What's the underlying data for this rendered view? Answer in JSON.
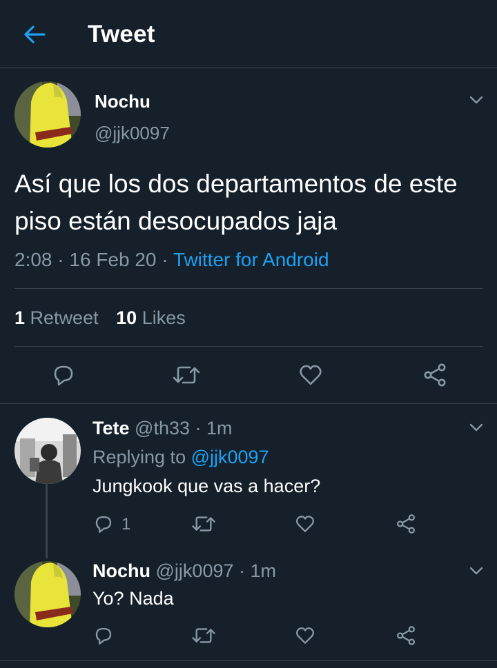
{
  "header": {
    "title": "Tweet"
  },
  "tweet": {
    "name": "Nochu",
    "handle": "@jjk0097",
    "text": "Así que los dos departamentos de este piso están desocupados jaja",
    "time": "2:08",
    "date": "16 Feb 20",
    "separator": "·",
    "source": "Twitter for Android",
    "retweet_count": "1",
    "retweet_label": "Retweet",
    "like_count": "10",
    "like_label": "Likes"
  },
  "replies": [
    {
      "name": "Tete",
      "handle": "@th33",
      "time": "1m",
      "replying_label": "Replying to",
      "replying_handle": "@jjk0097",
      "text": "Jungkook que vas a hacer?",
      "reply_count": "1"
    },
    {
      "name": "Nochu",
      "handle": "@jjk0097",
      "time": "1m",
      "text": "Yo? Nada"
    }
  ],
  "icons": {
    "back": "arrow-left-icon",
    "menu": "chevron-down-icon",
    "reply": "speech-bubble-icon",
    "retweet": "retweet-icon",
    "like": "heart-icon",
    "share": "share-icon"
  },
  "colors": {
    "background": "#15202b",
    "accent": "#1da1f2",
    "secondary_text": "#8899a6",
    "divider": "#38444d"
  }
}
